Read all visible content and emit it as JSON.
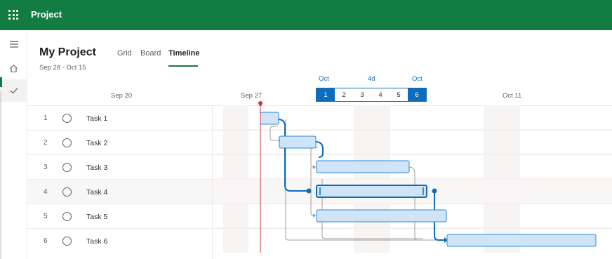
{
  "app": {
    "title": "Project"
  },
  "nav": {
    "items": [
      {
        "icon": "hamburger-icon",
        "active": false
      },
      {
        "icon": "home-icon",
        "active": false
      },
      {
        "icon": "checkmark-icon",
        "active": true
      }
    ]
  },
  "project": {
    "title": "My Project",
    "dates": "Sep 28 - Oct 15"
  },
  "view_tabs": [
    {
      "label": "Grid",
      "selected": false
    },
    {
      "label": "Board",
      "selected": false
    },
    {
      "label": "Timeline",
      "selected": true
    }
  ],
  "timeline": {
    "header_dates": [
      "Sep 20",
      "Sep 27",
      "Oct 11"
    ],
    "selection": {
      "start_month": "Oct",
      "duration": "4d",
      "end_month": "Oct"
    },
    "day_numbers": [
      "1",
      "2",
      "3",
      "4",
      "5",
      "6"
    ],
    "today": "Sep 27"
  },
  "tasks": [
    {
      "num": "1",
      "name": "Task 1"
    },
    {
      "num": "2",
      "name": "Task 2"
    },
    {
      "num": "3",
      "name": "Task 3"
    },
    {
      "num": "4",
      "name": "Task 4"
    },
    {
      "num": "5",
      "name": "Task 5"
    },
    {
      "num": "6",
      "name": "Task 6"
    }
  ],
  "colors": {
    "brand": "#137c42",
    "accent": "#0f6cbd",
    "bar_fill": "#cfe4f6",
    "bar_border": "#2b88d8",
    "today_line": "#d13438",
    "dependency_link": "#a19f9d"
  }
}
